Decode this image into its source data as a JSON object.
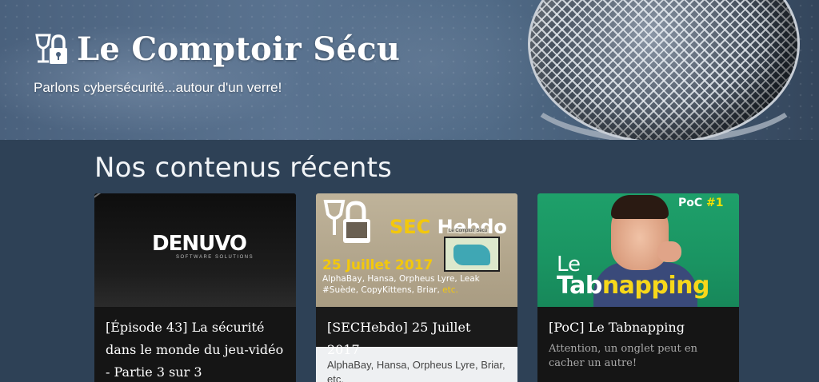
{
  "header": {
    "site_title": "Le Comptoir Sécu",
    "tagline": "Parlons cybersécurité...autour d'un verre!",
    "logo_icon": "wineglass-lock-icon"
  },
  "main": {
    "section_title": "Nos contenus récents",
    "cards": [
      {
        "title": "[Épisode 43] La sécurité dans le monde du jeu-vidéo - Partie 3 sur 3",
        "thumb": {
          "logo": "DENUVO",
          "sub": "SOFTWARE SOLUTIONS"
        }
      },
      {
        "title": "[SECHebdo] 25 Juillet 2017",
        "description": "AlphaBay, Hansa, Orpheus Lyre, Briar, etc.",
        "thumb": {
          "heading_a": "SEC",
          "heading_b": " Hebdo",
          "date": "25 Juillet 2017",
          "list": "AlphaBay, Hansa, Orpheus Lyre, Leak #Suède, CopyKittens, Briar,",
          "etc": " etc.",
          "badge": "Le Comptoir Sécu"
        }
      },
      {
        "title": "[PoC] Le Tabnapping",
        "description": "Attention, un onglet peut en cacher un autre!",
        "thumb": {
          "poc": "PoC ",
          "poc_num": "#1",
          "le": "Le",
          "tab_a": "Tab",
          "tab_b": "napping"
        }
      }
    ]
  },
  "colors": {
    "background": "#2e4156",
    "accent_yellow": "#f3c80c",
    "poc_green": "#1ea06a"
  }
}
